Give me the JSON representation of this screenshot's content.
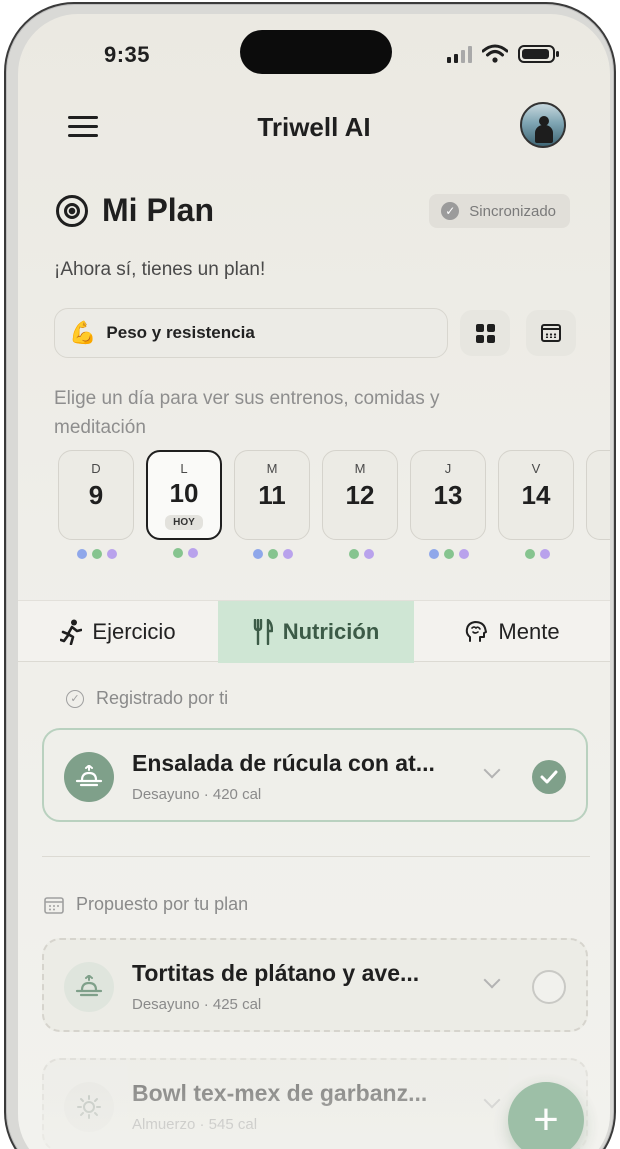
{
  "status_bar": {
    "time": "9:35"
  },
  "header": {
    "app_title": "Triwell AI",
    "menu_icon": "hamburger-icon",
    "avatar_icon": "avatar"
  },
  "plan": {
    "title": "Mi Plan",
    "sync_label": "Sincronizado",
    "subtitle": "¡Ahora sí, tienes un plan!",
    "plan_type": {
      "emoji": "💪",
      "label": "Peso y resistencia"
    },
    "hint": "Elige un día para ver sus entrenos, comidas y meditación"
  },
  "colors": {
    "accent_green": "#7fa08a",
    "tab_active_bg": "#cfe6d4",
    "dot_blue": "#8fa7ea",
    "dot_green": "#86c48f",
    "dot_purple": "#b9a2ec"
  },
  "days": [
    {
      "letter": "D",
      "number": "9",
      "dots": [
        "blue",
        "green",
        "purple"
      ]
    },
    {
      "letter": "L",
      "number": "10",
      "today_label": "HOY",
      "dots": [
        "green",
        "purple"
      ]
    },
    {
      "letter": "M",
      "number": "11",
      "dots": [
        "blue",
        "green",
        "purple"
      ]
    },
    {
      "letter": "M",
      "number": "12",
      "dots": [
        "green",
        "purple"
      ]
    },
    {
      "letter": "J",
      "number": "13",
      "dots": [
        "blue",
        "green",
        "purple"
      ]
    },
    {
      "letter": "V",
      "number": "14",
      "dots": [
        "green",
        "purple"
      ]
    }
  ],
  "tabs": [
    {
      "label": "Ejercicio",
      "icon": "running-person-icon"
    },
    {
      "label": "Nutrición",
      "icon": "fork-knife-icon",
      "active": true
    },
    {
      "label": "Mente",
      "icon": "brain-icon"
    }
  ],
  "sections": {
    "logged": "Registrado por ti",
    "proposed": "Propuesto por tu plan"
  },
  "logged_meals": [
    {
      "title": "Ensalada de rúcula con at...",
      "subtitle": "Desayuno · 420 cal",
      "icon": "sunrise-icon",
      "checked": true
    }
  ],
  "proposed_meals": [
    {
      "title": "Tortitas de plátano y ave...",
      "subtitle": "Desayuno · 425 cal",
      "icon": "sunrise-icon",
      "checked": false
    },
    {
      "title": "Bowl tex-mex de garbanz...",
      "subtitle": "Almuerzo · 545 cal",
      "icon": "sun-icon",
      "checked": false
    }
  ],
  "fab": {
    "label": "+"
  }
}
